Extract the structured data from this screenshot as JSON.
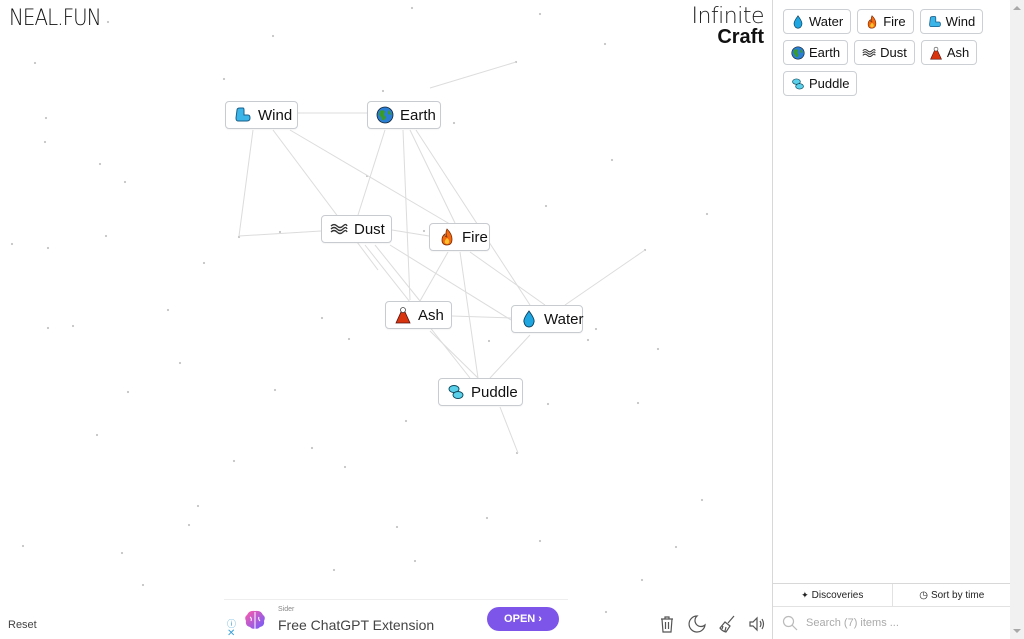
{
  "header": {
    "logo": "NEAL.FUN",
    "title_line1": "Infinite",
    "title_line2": "Craft"
  },
  "canvas": {
    "nodes": [
      {
        "name": "Wind",
        "icon": "wind-icon"
      },
      {
        "name": "Earth",
        "icon": "earth-globe-icon"
      },
      {
        "name": "Dust",
        "icon": "dust-waves-icon"
      },
      {
        "name": "Fire",
        "icon": "fire-icon"
      },
      {
        "name": "Ash",
        "icon": "ash-volcano-icon"
      },
      {
        "name": "Water",
        "icon": "water-drop-icon"
      },
      {
        "name": "Puddle",
        "icon": "puddle-icon"
      }
    ],
    "reset_label": "Reset"
  },
  "sidebar": {
    "items": [
      {
        "name": "Water",
        "icon": "water-drop-icon"
      },
      {
        "name": "Fire",
        "icon": "fire-icon"
      },
      {
        "name": "Wind",
        "icon": "wind-icon"
      },
      {
        "name": "Earth",
        "icon": "earth-globe-icon"
      },
      {
        "name": "Dust",
        "icon": "dust-waves-icon"
      },
      {
        "name": "Ash",
        "icon": "ash-volcano-icon"
      },
      {
        "name": "Puddle",
        "icon": "puddle-icon"
      }
    ],
    "tab_discoveries": "Discoveries",
    "tab_sort": "Sort by time",
    "search_placeholder": "Search (7) items ..."
  },
  "ad": {
    "sponsor": "Sider",
    "headline": "Free ChatGPT Extension",
    "cta": "OPEN ›",
    "cta_color": "#7d55e8"
  },
  "toolbar": {
    "icons": [
      "trash-icon",
      "dark-mode-moon-icon",
      "broom-clear-icon",
      "sound-speaker-icon"
    ]
  }
}
